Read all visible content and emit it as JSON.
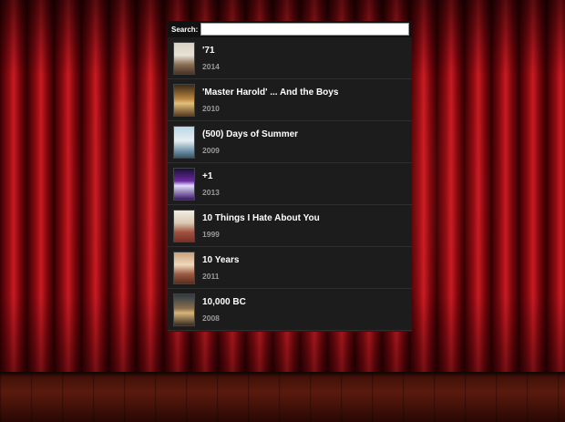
{
  "search": {
    "label": "Search:",
    "value": "",
    "placeholder": ""
  },
  "movies": [
    {
      "title": "'71",
      "year": "2014"
    },
    {
      "title": "'Master Harold' ... And the Boys",
      "year": "2010"
    },
    {
      "title": "(500) Days of Summer",
      "year": "2009"
    },
    {
      "title": "+1",
      "year": "2013"
    },
    {
      "title": "10 Things I Hate About You",
      "year": "1999"
    },
    {
      "title": "10 Years",
      "year": "2011"
    },
    {
      "title": "10,000 BC",
      "year": "2008"
    }
  ],
  "colors": {
    "panel_bg": "#1d1d1d",
    "title_text": "#ffffff",
    "year_text": "#9a9a9a",
    "curtain_red": "#c91a22"
  }
}
